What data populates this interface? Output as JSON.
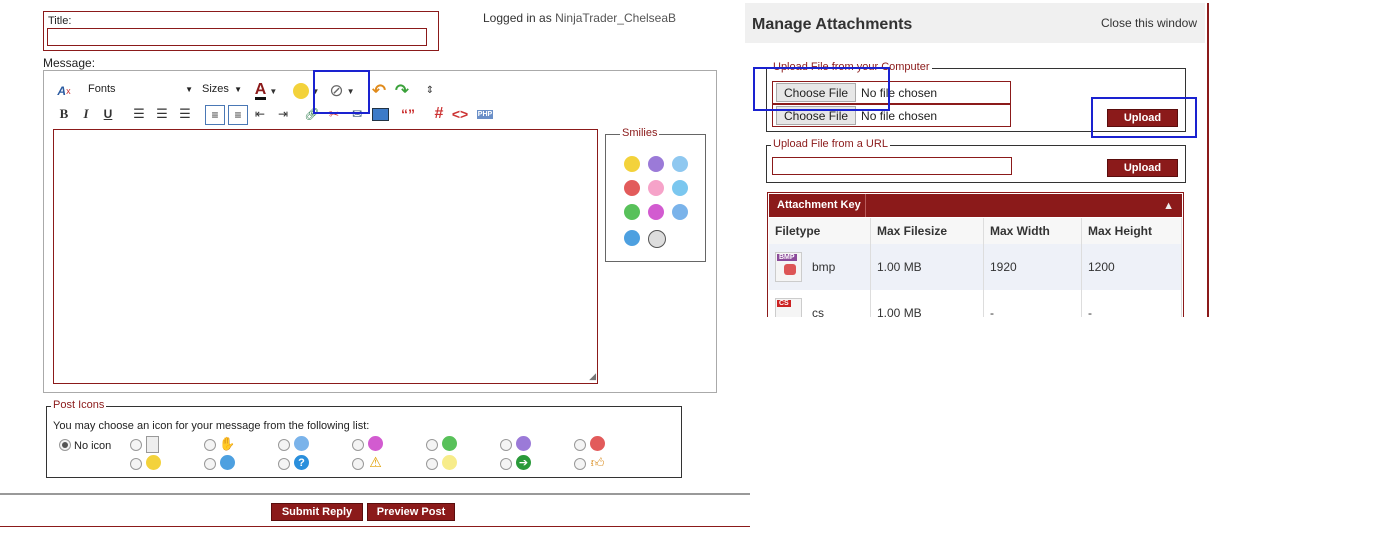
{
  "form": {
    "title_label": "Title:",
    "logged_prefix": "Logged in as ",
    "username": "NinjaTrader_ChelseaB",
    "message_label": "Message:",
    "toolbar": {
      "fonts_label": "Fonts",
      "sizes_label": "Sizes"
    },
    "smilies_label": "Smilies",
    "post_icons_label": "Post Icons",
    "post_icons_hint": "You may choose an icon for your message from the following list:",
    "no_icon_label": "No icon",
    "submit_label": "Submit Reply",
    "preview_label": "Preview Post"
  },
  "attachments": {
    "title": "Manage Attachments",
    "close_label": "Close this window",
    "upload_computer_label": "Upload File from your Computer",
    "choose_file_label": "Choose File",
    "no_file_label": "No file chosen",
    "upload_label": "Upload",
    "upload_url_label": "Upload File from a URL",
    "key_title": "Attachment Key",
    "columns": [
      "Filetype",
      "Max Filesize",
      "Max Width",
      "Max Height"
    ],
    "rows": [
      {
        "type": "bmp",
        "tag": "BMP",
        "size": "1.00 MB",
        "width": "1920",
        "height": "1200"
      },
      {
        "type": "cs",
        "tag": "CS",
        "size": "1.00 MB",
        "width": "-",
        "height": "-"
      }
    ]
  },
  "colors": {
    "accent": "#8b1a1a",
    "highlight": "#1a22d0"
  }
}
